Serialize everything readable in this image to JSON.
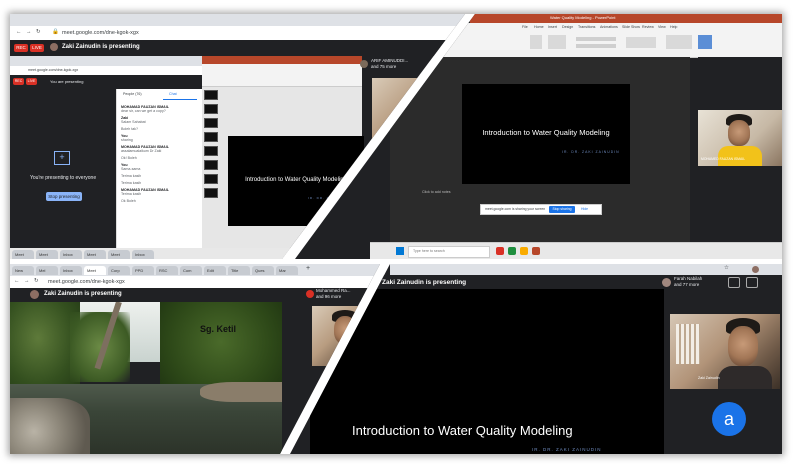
{
  "panel_top_left": {
    "url": "meet.google.com/dne-kgok-xgx",
    "rec_badge": "REC",
    "live_badge": "LIVE",
    "presenting_banner": "Zaki Zainudin is presenting",
    "participants_name": "ARIF AMINUDDI...",
    "participants_more": "and 75 more",
    "inner_url": "meet.google.com/dne-kgok-xgx",
    "inner_presenting": "You are presenting",
    "present_message": "You're presenting to everyone",
    "stop_presenting": "Stop presenting",
    "chat_tab_people": "People (76)",
    "chat_tab_chat": "Chat",
    "chat_messages": [
      {
        "name": "MOHAMAD FAUZAN ISMAIL",
        "text": "dear sir, can we get a copy?"
      },
      {
        "name": "Zaki",
        "text": "Salam Sahabat"
      },
      {
        "name": "",
        "text": "Boleh tak?"
      },
      {
        "name": "You",
        "text": "sharing"
      },
      {
        "name": "MOHAMAD FAUZAN ISMAIL",
        "text": "assalamualaikum Dr Zaki"
      },
      {
        "name": "",
        "text": "Ok! Boleh"
      },
      {
        "name": "You",
        "text": "Sama-sama"
      },
      {
        "name": "",
        "text": "Terima kasih"
      },
      {
        "name": "",
        "text": "Terima kasih"
      },
      {
        "name": "MOHAMAD FAUZAN ISMAIL",
        "text": "Terima kasih"
      },
      {
        "name": "",
        "text": "Ok Boleh"
      }
    ],
    "slide_title": "Introduction to Water Quality Modeling",
    "slide_author": "IR. DR. ZAKI ZAINUDIN",
    "self_tile_name": "mohamadzainudin",
    "win_tabs": [
      "Meet",
      "Meet",
      "Inbox",
      "Meet",
      "Meet",
      "Inbox"
    ]
  },
  "panel_top_right": {
    "slide_title": "Introduction to Water Quality Modeling",
    "slide_author": "IR. DR. ZAKI ZAINUDIN",
    "camera_name": "MOHAMED FAUZAN ISMAIL",
    "share_bar_text": "meet.google.com is sharing your screen",
    "share_stop": "Stop sharing",
    "share_hide": "Hide",
    "search_placeholder": "Type here to search",
    "ribbon_tabs": [
      "File",
      "Home",
      "Insert",
      "Design",
      "Transitions",
      "Animations",
      "Slide Show",
      "Review",
      "View",
      "Help"
    ],
    "title_bar": "Water Quality Modeling - PowerPoint",
    "notes_label": "Click to add notes"
  },
  "panel_bottom_left": {
    "tabs": [
      "New",
      "Mel",
      "Inbox",
      "Meet",
      "Corp",
      "PPD",
      "RSC",
      "Com",
      "Edit",
      "Title",
      "Ques",
      "Mar"
    ],
    "url": "meet.google.com/dne-kgok-xgx",
    "presenting_banner": "Zaki Zainudin is presenting",
    "participants_name": "Mohammed Ra...",
    "participants_more": "and 96 more",
    "river_label": "Sg. Ketil"
  },
  "panel_bottom_right": {
    "presenting_banner": "Zaki Zainudin is presenting",
    "participants_name": "Farah Nabilah",
    "participants_more": "and 77 more",
    "slide_title": "Introduction to Water Quality Modeling",
    "slide_author": "IR. DR. ZAKI ZAINUDIN",
    "camera_name": "Zaki Zainudin",
    "avatar_letter": "a",
    "avatar_color": "#1a73e8"
  },
  "colors": {
    "meet_dark": "#202124",
    "rec_red": "#d93025",
    "ppt_orange": "#b7472a",
    "slide_author_blue": "#6f8cc0"
  }
}
